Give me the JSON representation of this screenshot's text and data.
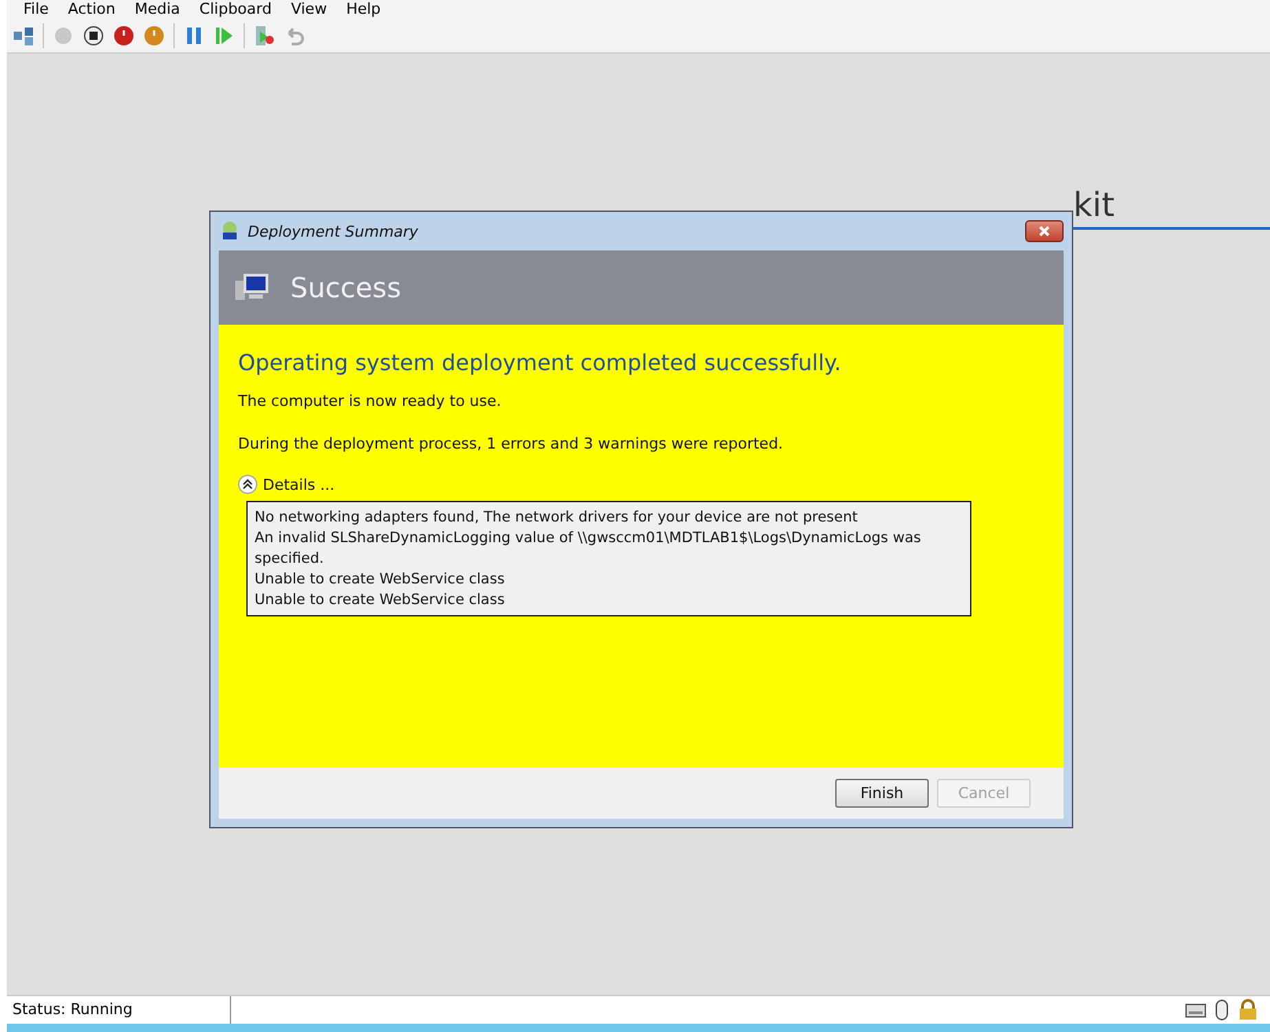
{
  "menu": [
    "File",
    "Action",
    "Media",
    "Clipboard",
    "View",
    "Help"
  ],
  "background": {
    "heading_fragment": "kit"
  },
  "dialog": {
    "title": "Deployment Summary",
    "banner": "Success",
    "headline": "Operating system deployment completed successfully.",
    "messages": [
      "The computer is now ready to use.",
      "During the deployment process, 1 errors and 3 warnings were reported."
    ],
    "details": {
      "label": "Details ...",
      "expanded": true,
      "lines": [
        "No networking adapters found, The network drivers for your device are not present",
        "An invalid SLShareDynamicLogging value of \\\\gwsccm01\\MDTLAB1$\\Logs\\DynamicLogs was specified.",
        "Unable to create WebService class",
        "Unable to create WebService class"
      ]
    },
    "buttons": [
      {
        "label": "Finish",
        "disabled": false
      },
      {
        "label": "Cancel",
        "disabled": true
      }
    ]
  },
  "status_bar": {
    "status": "Status: Running"
  }
}
